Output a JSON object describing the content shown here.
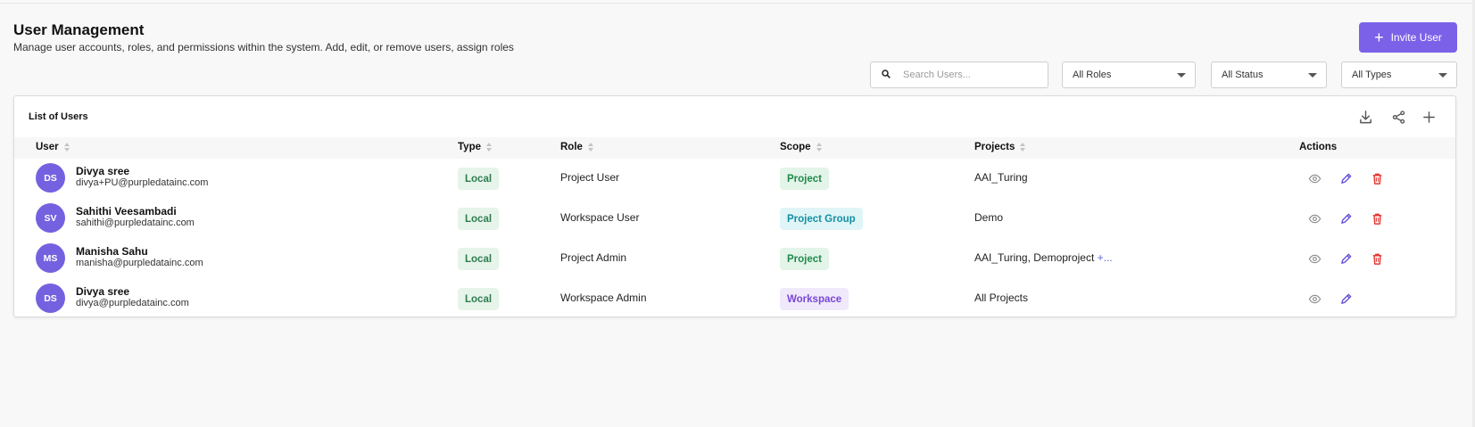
{
  "header": {
    "title": "User Management",
    "subtitle": "Manage user accounts, roles, and permissions within the system. Add, edit, or remove users, assign roles",
    "invite_label": "Invite User",
    "invite_icon": "plus-icon"
  },
  "filters": {
    "search_placeholder": "Search Users...",
    "search_value": "",
    "roles": "All Roles",
    "status": "All Status",
    "types": "All Types"
  },
  "card": {
    "title": "List of Users",
    "tools": [
      "download-icon",
      "share-icon",
      "plus-icon"
    ]
  },
  "table": {
    "headers": {
      "user": "User",
      "type": "Type",
      "role": "Role",
      "scope": "Scope",
      "projects": "Projects",
      "actions": "Actions"
    },
    "rows": [
      {
        "initials": "DS",
        "name": "Divya sree",
        "email": "divya+PU@purpledatainc.com",
        "type": "Local",
        "role": "Project User",
        "scope": "Project",
        "projects": "AAI_Turing",
        "projects_more": "",
        "can_delete": true
      },
      {
        "initials": "SV",
        "name": "Sahithi Veesambadi",
        "email": "sahithi@purpledatainc.com",
        "type": "Local",
        "role": "Workspace User",
        "scope": "Project Group",
        "projects": "Demo",
        "projects_more": "",
        "can_delete": true
      },
      {
        "initials": "MS",
        "name": "Manisha Sahu",
        "email": "manisha@purpledatainc.com",
        "type": "Local",
        "role": "Project Admin",
        "scope": "Project",
        "projects": "AAI_Turing, Demoproject",
        "projects_more": "+...",
        "can_delete": true
      },
      {
        "initials": "DS",
        "name": "Divya sree",
        "email": "divya@purpledatainc.com",
        "type": "Local",
        "role": "Workspace Admin",
        "scope": "Workspace",
        "projects": "All Projects",
        "projects_more": "",
        "can_delete": false
      }
    ]
  },
  "colors": {
    "accent": "#7b61e8",
    "avatar": "#7461e0",
    "local_bg": "#e6f4ea",
    "local_fg": "#2e7d4f",
    "project_bg": "#e3f4e8",
    "project_fg": "#1f8a4c",
    "group_bg": "#e0f5f7",
    "group_fg": "#1390a3",
    "workspace_bg": "#efe9fb",
    "workspace_fg": "#7b45d6",
    "edit": "#6a4fd8",
    "delete": "#e53935",
    "view": "#8a8a8a"
  }
}
